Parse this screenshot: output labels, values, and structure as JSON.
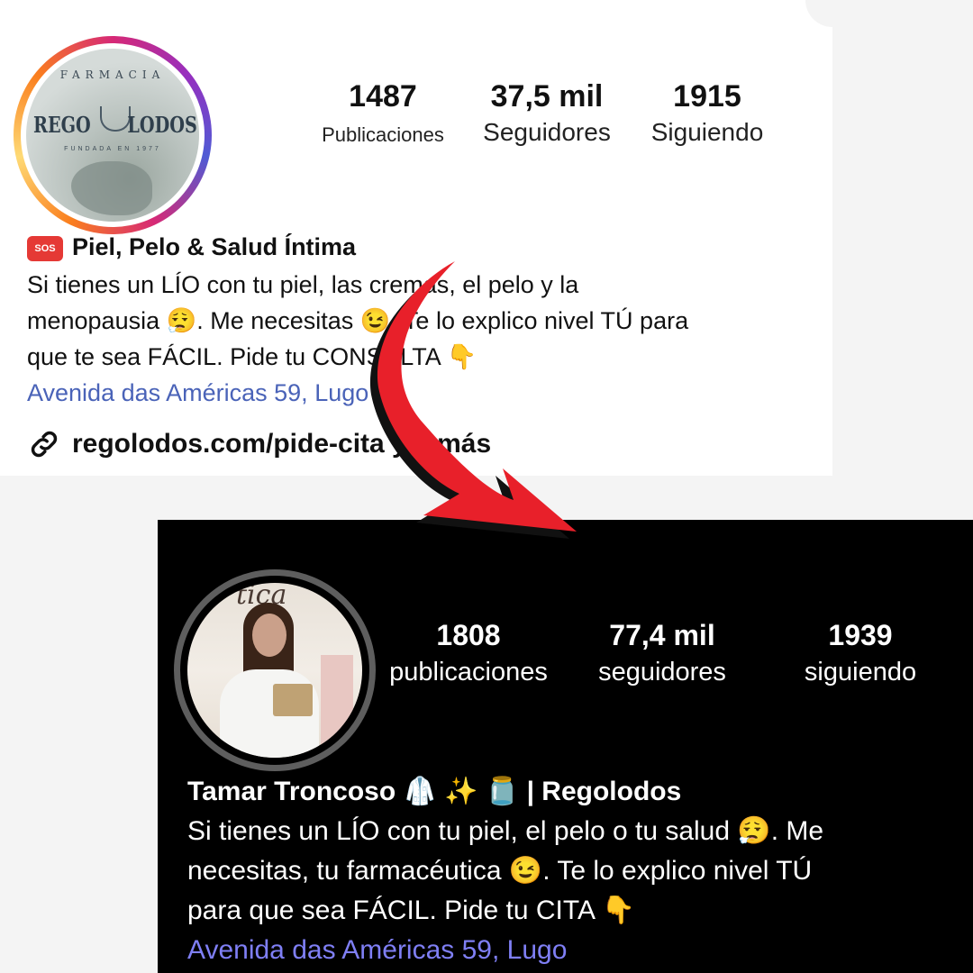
{
  "top_profile": {
    "logo": {
      "top_text": "FARMACIA",
      "left_text": "REGO",
      "right_text": "LODOS",
      "sub_text": "FUNDADA EN 1977"
    },
    "stats": [
      {
        "value": "1487",
        "label": "Publicaciones"
      },
      {
        "value": "37,5 mil",
        "label": "Seguidores"
      },
      {
        "value": "1915",
        "label": "Siguiendo"
      }
    ],
    "name": "Piel, Pelo & Salud Íntima",
    "sos_badge": "SOS",
    "bio_lines": [
      "Si tienes un LÍO con tu piel, las cremas, el pelo y la",
      "menopausia 😮‍💨. Me necesitas 😉. Te lo explico nivel TÚ para",
      "que te sea FÁCIL. Pide tu CONSULTA 👇"
    ],
    "location": "Avenida das Américas 59, Lugo",
    "link": "regolodos.com/pide-cita y 1 más"
  },
  "bottom_profile": {
    "photo_script": "tica",
    "stats": [
      {
        "value": "1808",
        "label": "publicaciones"
      },
      {
        "value": "77,4 mil",
        "label": "seguidores"
      },
      {
        "value": "1939",
        "label": "siguiendo"
      }
    ],
    "name": "Tamar Troncoso 🥼 ✨ 🫙 | Regolodos",
    "bio_lines": [
      "Si tienes un LÍO con tu piel, el pelo o tu salud 😮‍💨. Me",
      "necesitas, tu farmacéutica 😉. Te lo explico nivel TÚ",
      "para que sea FÁCIL. Pide tu CITA 👇"
    ],
    "location": "Avenida das Américas 59, Lugo"
  },
  "colors": {
    "arrow": "#e8202a",
    "link_blue_light": "#4a63b8",
    "link_blue_dark": "#7f7ff5"
  },
  "icons": [
    "sos-icon",
    "link-icon",
    "curved-arrow-icon"
  ]
}
